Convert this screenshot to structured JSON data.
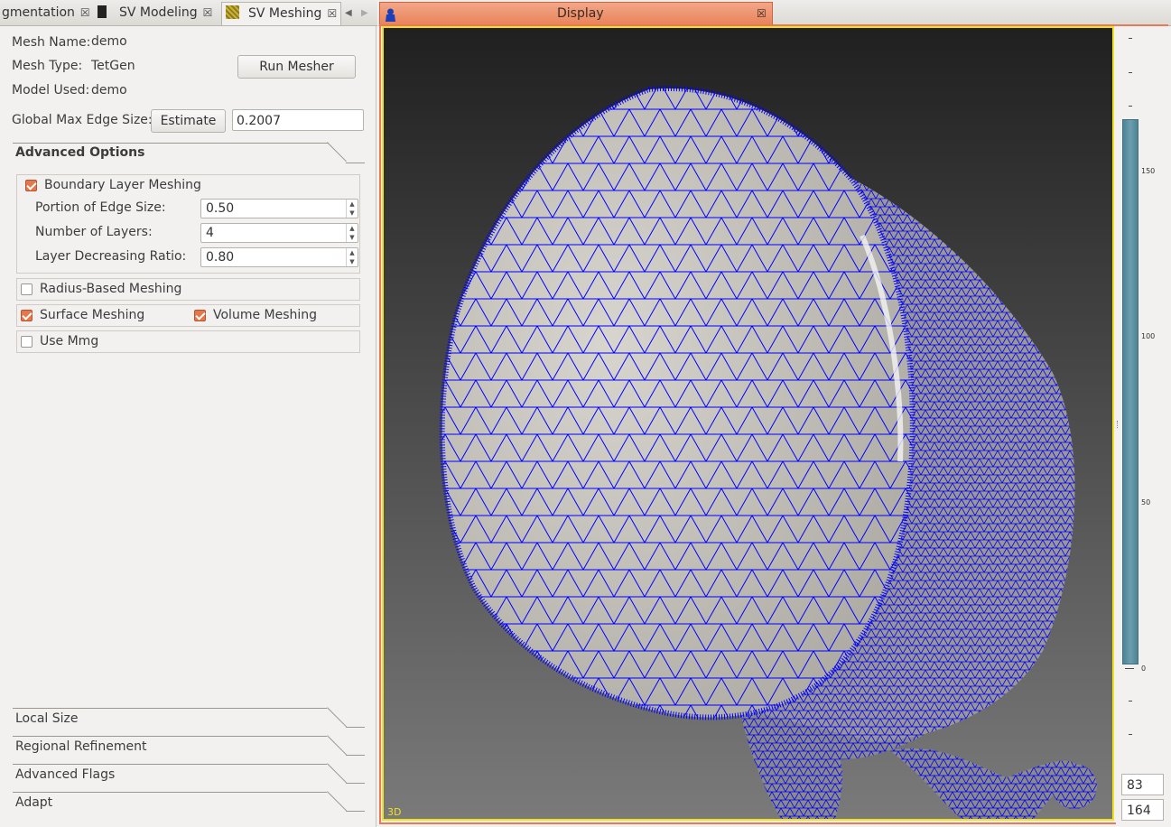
{
  "tabs": {
    "segmentation": "gmentation",
    "modeling": "SV Modeling",
    "meshing": "SV Meshing",
    "display": "Display"
  },
  "mesh": {
    "name_label": "Mesh Name:",
    "name_value": "demo",
    "type_label": "Mesh Type:",
    "type_value": "TetGen",
    "model_label": "Model Used:",
    "model_value": "demo",
    "run_button": "Run Mesher",
    "edge_label": "Global Max Edge Size:",
    "estimate_button": "Estimate",
    "edge_value": "0.2007"
  },
  "advanced": {
    "title": "Advanced Options",
    "boundary_layer": "Boundary Layer Meshing",
    "portion_label": "Portion of Edge Size:",
    "portion_value": "0.50",
    "layers_label": "Number of Layers:",
    "layers_value": "4",
    "ratio_label": "Layer Decreasing Ratio:",
    "ratio_value": "0.80",
    "radius_based": "Radius-Based Meshing",
    "surface": "Surface Meshing",
    "volume": "Volume Meshing",
    "mmg": "Use Mmg"
  },
  "checks": {
    "boundary_layer": true,
    "radius_based": false,
    "surface": true,
    "volume": true,
    "mmg": false
  },
  "sections": [
    "Local Size",
    "Regional Refinement",
    "Advanced Flags",
    "Adapt"
  ],
  "display": {
    "view_label": "3D",
    "scale_ticks": [
      "150",
      "100",
      "50",
      "0"
    ],
    "slice_upper": "83",
    "slice_lower": "164"
  },
  "colors": {
    "accent": "#e5774d",
    "mesh_wire": "#0000ff",
    "viewport_border": "#f2e21c"
  }
}
